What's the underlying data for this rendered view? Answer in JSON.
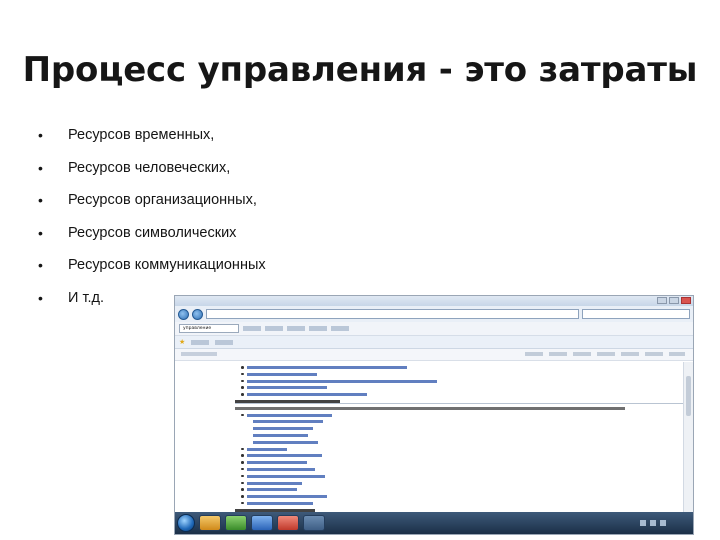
{
  "slide": {
    "title": "Процесс управления  -  это затраты",
    "bullets": [
      "Ресурсов  временных,",
      "Ресурсов человеческих,",
      "Ресурсов организационных,",
      "Ресурсов символических",
      "Ресурсов коммуникационных",
      "И т.д."
    ],
    "bullet_glyph": "•"
  },
  "screenshot": {
    "search_value": "управление",
    "colors": {
      "link": "#3a5fb0",
      "titlebar": "#c7d6e8",
      "taskbar": "#1b2f47"
    },
    "icons": [
      "back-icon",
      "forward-icon",
      "favorites-star-icon",
      "start-orb-icon"
    ]
  }
}
